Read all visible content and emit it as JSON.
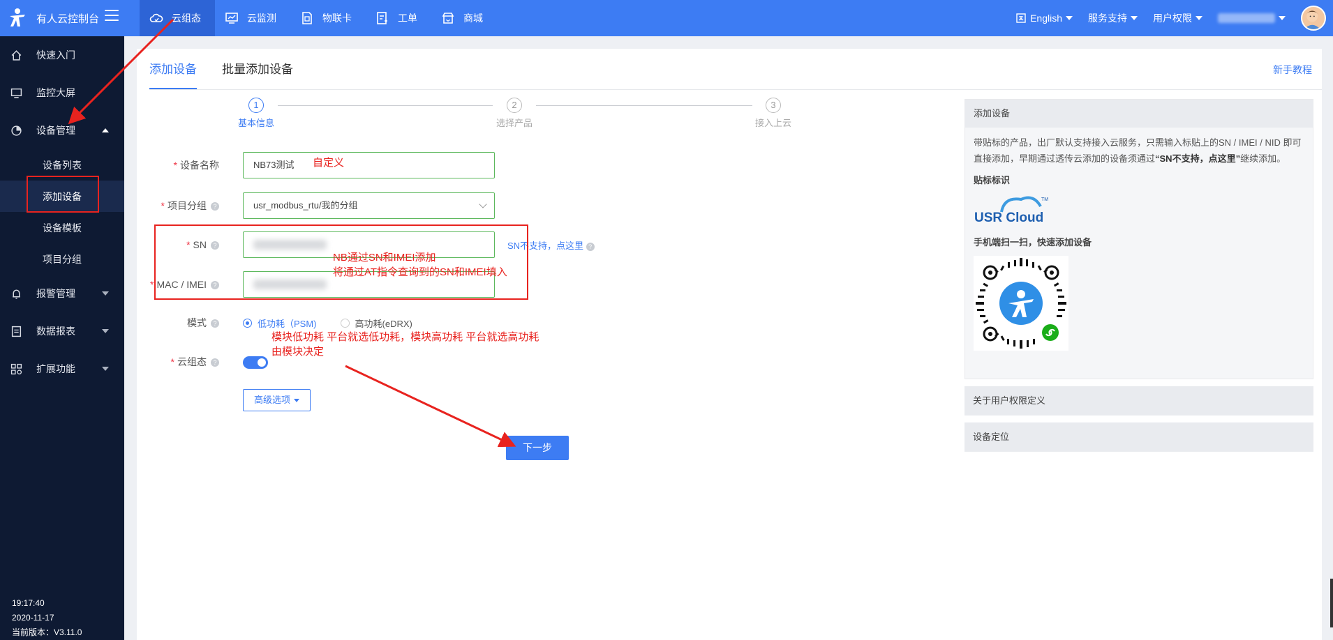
{
  "header": {
    "brand": "有人云控制台",
    "nav": [
      {
        "label": "云组态",
        "icon": "cloud-icon",
        "active": true
      },
      {
        "label": "云监测",
        "icon": "monitor-icon"
      },
      {
        "label": "物联卡",
        "icon": "sim-card-icon"
      },
      {
        "label": "工单",
        "icon": "ticket-icon"
      },
      {
        "label": "商城",
        "icon": "shop-icon"
      }
    ],
    "language": "English",
    "support": "服务支持",
    "permissions": "用户权限"
  },
  "sidebar": {
    "items": [
      {
        "label": "快速入门",
        "icon": "home-icon"
      },
      {
        "label": "监控大屏",
        "icon": "screen-icon"
      },
      {
        "label": "设备管理",
        "icon": "device-icon",
        "expanded": true
      }
    ],
    "sub_items": [
      {
        "label": "设备列表"
      },
      {
        "label": "添加设备",
        "active": true
      },
      {
        "label": "设备模板"
      },
      {
        "label": "项目分组"
      }
    ],
    "items_after": [
      {
        "label": "报警管理",
        "icon": "alarm-icon"
      },
      {
        "label": "数据报表",
        "icon": "report-icon"
      },
      {
        "label": "扩展功能",
        "icon": "extension-icon"
      }
    ],
    "time": "19:17:40",
    "date": "2020-11-17",
    "version": "当前版本：V3.11.0"
  },
  "tabs": [
    {
      "label": "添加设备",
      "active": true
    },
    {
      "label": "批量添加设备"
    }
  ],
  "help_link": "新手教程",
  "steps": [
    {
      "num": "1",
      "label": "基本信息",
      "active": true
    },
    {
      "num": "2",
      "label": "选择产品"
    },
    {
      "num": "3",
      "label": "接入上云"
    }
  ],
  "form": {
    "device_name_label": "设备名称",
    "device_name_value": "NB73测试",
    "group_label": "项目分组",
    "group_value": "usr_modbus_rtu/我的分组",
    "sn_label": "SN",
    "sn_link": "SN不支持，点这里",
    "imei_label": "MAC / IMEI",
    "mode_label": "模式",
    "mode_options": [
      {
        "label": "低功耗（PSM)",
        "selected": true
      },
      {
        "label": "高功耗(eDRX)",
        "selected": false
      }
    ],
    "cloud_label": "云组态",
    "cloud_enabled": true,
    "advanced_button": "高级选项",
    "next_button": "下一步"
  },
  "annotations": {
    "custom": "自定义",
    "sn_note_1": "NB通过SN和IMEI添加",
    "sn_note_2": "将通过AT指令查询到的SN和IMEI填入",
    "mode_note_1": "模块低功耗 平台就选低功耗，模块高功耗 平台就选高功耗",
    "mode_note_2": "由模块决定"
  },
  "panel": {
    "title": "添加设备",
    "desc_1": "带贴标的产品，出厂默认支持接入云服务，只需输入标贴上的SN / IMEI / NID 即可直接添加，早期通过透传云添加的设备须通过",
    "desc_bold": "“SN不支持，点这里”",
    "desc_2": "继续添加。",
    "label_title": "贴标标识",
    "logo_text": "USR Cloud",
    "logo_tm": "TM",
    "scan_title": "手机端扫一扫，快速添加设备"
  },
  "collapsed_panels": [
    {
      "label": "关于用户权限定义"
    },
    {
      "label": "设备定位"
    }
  ],
  "colors": {
    "primary": "#3d7cf3",
    "sidebar_bg": "#0e1a33",
    "annotation_red": "#e8231f"
  }
}
